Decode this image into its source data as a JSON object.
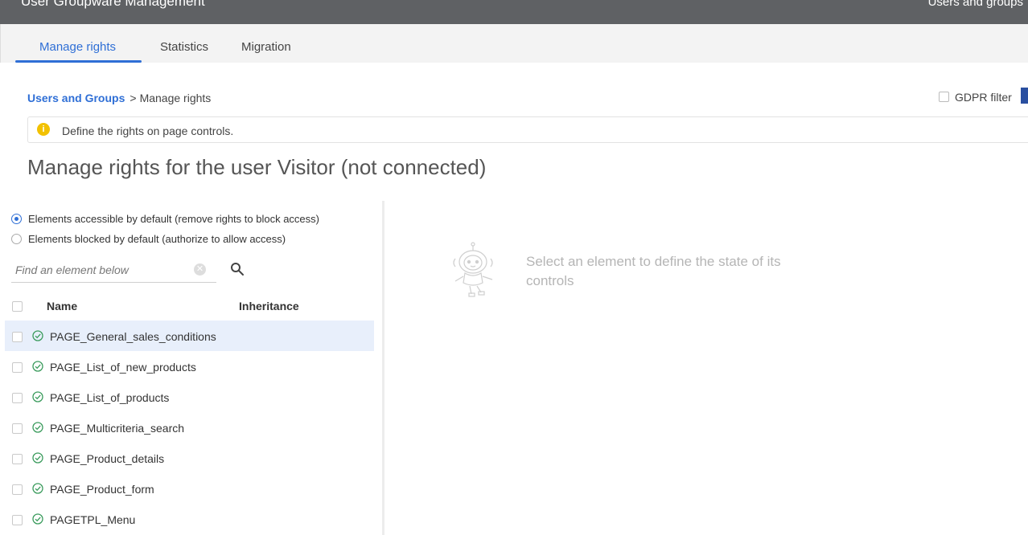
{
  "app": {
    "title": "User Groupware Management",
    "top_link": "Users and groups"
  },
  "tabs": [
    {
      "label": "Manage rights",
      "active": true
    },
    {
      "label": "Statistics",
      "active": false
    },
    {
      "label": "Migration",
      "active": false
    }
  ],
  "breadcrumb": {
    "link": "Users and Groups",
    "separator": ">",
    "current": "Manage rights"
  },
  "gdpr": {
    "label": "GDPR filter",
    "checked": false
  },
  "info": {
    "text": "Define the rights on page controls."
  },
  "page": {
    "title": "Manage rights for the user Visitor (not connected)"
  },
  "mode": {
    "accessible_label": "Elements accessible by default (remove rights to block access)",
    "blocked_label": "Elements blocked by default (authorize to allow access)",
    "selected": "accessible"
  },
  "search": {
    "placeholder": "Find an element below",
    "value": ""
  },
  "table": {
    "columns": [
      "Name",
      "Inheritance"
    ],
    "rows": [
      {
        "name": "PAGE_General_sales_conditions",
        "selected": true
      },
      {
        "name": "PAGE_List_of_new_products",
        "selected": false
      },
      {
        "name": "PAGE_List_of_products",
        "selected": false
      },
      {
        "name": "PAGE_Multicriteria_search",
        "selected": false
      },
      {
        "name": "PAGE_Product_details",
        "selected": false
      },
      {
        "name": "PAGE_Product_form",
        "selected": false
      },
      {
        "name": "PAGETPL_Menu",
        "selected": false
      }
    ]
  },
  "empty_state": {
    "text": "Select an element to define the state of its controls"
  },
  "colors": {
    "accent": "#2f6fd6",
    "topbar": "#5f6164",
    "ok": "#3a9b5c",
    "warning": "#f2c100",
    "selected_row": "#e8effb"
  },
  "icons": {
    "info": "info-icon",
    "search": "search-icon",
    "clear": "clear-icon",
    "row_status": "check-circle-icon",
    "empty_state": "robot-illustration"
  }
}
